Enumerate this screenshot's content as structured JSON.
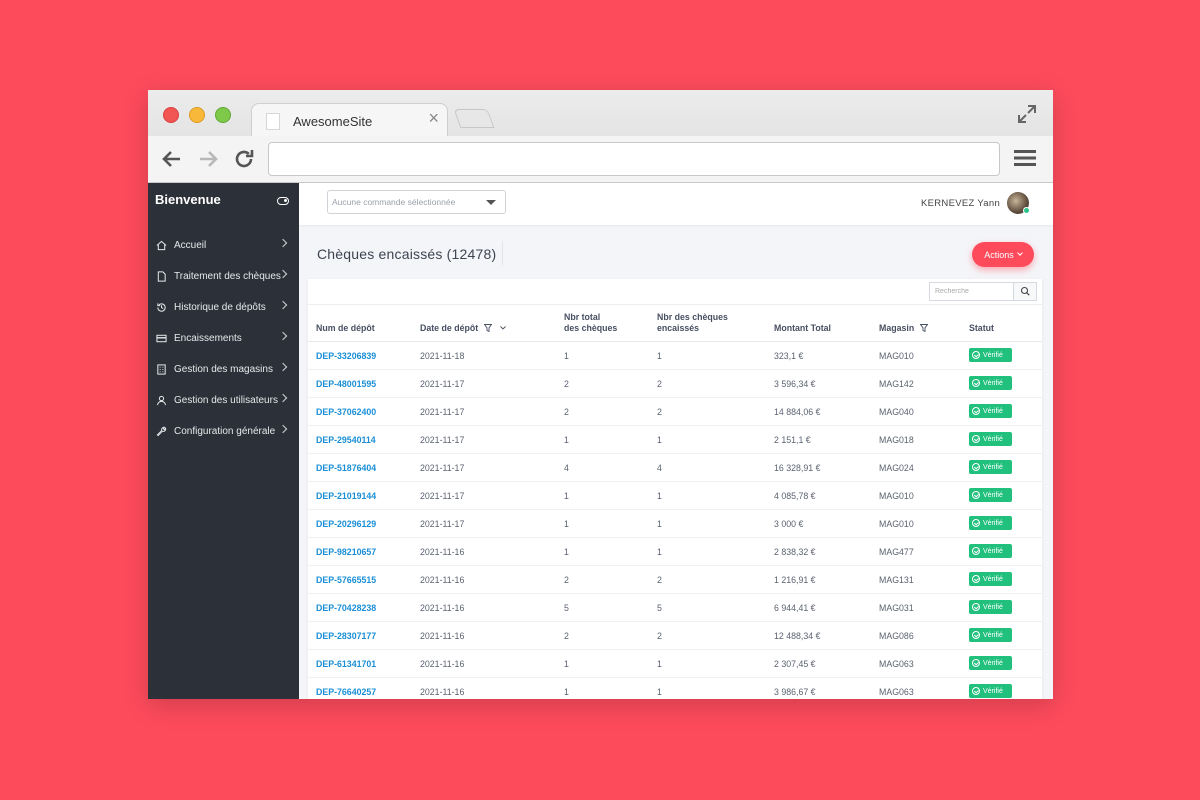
{
  "browser": {
    "tab_title": "AwesomeSite",
    "tab_close": "×",
    "url": ""
  },
  "sidebar": {
    "title": "Bienvenue",
    "items": [
      {
        "label": "Accueil",
        "icon": "home-icon"
      },
      {
        "label": "Traitement des chèques",
        "icon": "document-icon"
      },
      {
        "label": "Historique de dépôts",
        "icon": "history-icon"
      },
      {
        "label": "Encaissements",
        "icon": "card-icon"
      },
      {
        "label": "Gestion des magasins",
        "icon": "building-icon"
      },
      {
        "label": "Gestion des utilisateurs",
        "icon": "user-icon"
      },
      {
        "label": "Configuration générale",
        "icon": "wrench-icon"
      }
    ]
  },
  "topbar": {
    "order_select_value": "Aucune commande sélectionnée",
    "user_name": "KERNEVEZ Yann"
  },
  "page": {
    "title": "Chèques encaissés (12478)",
    "actions_label": "Actions"
  },
  "table": {
    "search_placeholder": "Recherche",
    "columns": {
      "num": "Num de dépôt",
      "date": "Date de dépôt",
      "total_line1": "Nbr total",
      "total_line2": "des chèques",
      "cashed_line1": "Nbr des chèques",
      "cashed_line2": "encaissés",
      "amount": "Montant Total",
      "store": "Magasin",
      "status": "Statut"
    },
    "rows": [
      {
        "num": "DEP-33206839",
        "date": "2021-11-18",
        "total": "1",
        "cashed": "1",
        "amount": "323,1 €",
        "store": "MAG010",
        "status": "Vérifié"
      },
      {
        "num": "DEP-48001595",
        "date": "2021-11-17",
        "total": "2",
        "cashed": "2",
        "amount": "3 596,34 €",
        "store": "MAG142",
        "status": "Vérifié"
      },
      {
        "num": "DEP-37062400",
        "date": "2021-11-17",
        "total": "2",
        "cashed": "2",
        "amount": "14 884,06 €",
        "store": "MAG040",
        "status": "Vérifié"
      },
      {
        "num": "DEP-29540114",
        "date": "2021-11-17",
        "total": "1",
        "cashed": "1",
        "amount": "2 151,1 €",
        "store": "MAG018",
        "status": "Vérifié"
      },
      {
        "num": "DEP-51876404",
        "date": "2021-11-17",
        "total": "4",
        "cashed": "4",
        "amount": "16 328,91 €",
        "store": "MAG024",
        "status": "Vérifié"
      },
      {
        "num": "DEP-21019144",
        "date": "2021-11-17",
        "total": "1",
        "cashed": "1",
        "amount": "4 085,78 €",
        "store": "MAG010",
        "status": "Vérifié"
      },
      {
        "num": "DEP-20296129",
        "date": "2021-11-17",
        "total": "1",
        "cashed": "1",
        "amount": "3 000 €",
        "store": "MAG010",
        "status": "Vérifié"
      },
      {
        "num": "DEP-98210657",
        "date": "2021-11-16",
        "total": "1",
        "cashed": "1",
        "amount": "2 838,32 €",
        "store": "MAG477",
        "status": "Vérifié"
      },
      {
        "num": "DEP-57665515",
        "date": "2021-11-16",
        "total": "2",
        "cashed": "2",
        "amount": "1 216,91 €",
        "store": "MAG131",
        "status": "Vérifié"
      },
      {
        "num": "DEP-70428238",
        "date": "2021-11-16",
        "total": "5",
        "cashed": "5",
        "amount": "6 944,41 €",
        "store": "MAG031",
        "status": "Vérifié"
      },
      {
        "num": "DEP-28307177",
        "date": "2021-11-16",
        "total": "2",
        "cashed": "2",
        "amount": "12 488,34 €",
        "store": "MAG086",
        "status": "Vérifié"
      },
      {
        "num": "DEP-61341701",
        "date": "2021-11-16",
        "total": "1",
        "cashed": "1",
        "amount": "2 307,45 €",
        "store": "MAG063",
        "status": "Vérifié"
      },
      {
        "num": "DEP-76640257",
        "date": "2021-11-16",
        "total": "1",
        "cashed": "1",
        "amount": "3 986,67 €",
        "store": "MAG063",
        "status": "Vérifié"
      }
    ]
  },
  "colors": {
    "background": "#fd4b5c",
    "accent": "#fd4b5c",
    "sidebar": "#2c3139",
    "link": "#1a8fd6",
    "status_ok": "#21c07d"
  }
}
